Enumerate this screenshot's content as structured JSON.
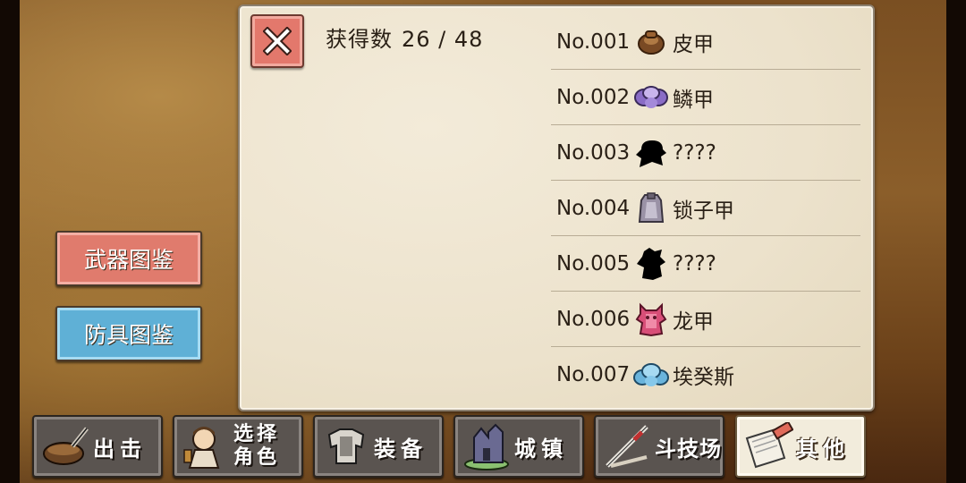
{
  "collection": {
    "count_label": "获得数",
    "count_value": "26 / 48"
  },
  "close_icon": "close-x-icon",
  "side_buttons": {
    "weapon_label": "武器图鉴",
    "armor_label": "防具图鉴"
  },
  "armor_list": [
    {
      "no": "No.001",
      "name": "皮甲",
      "icon": "leather-armor-icon"
    },
    {
      "no": "No.002",
      "name": "鳞甲",
      "icon": "scale-armor-icon"
    },
    {
      "no": "No.003",
      "name": "????",
      "icon": "unknown-silhouette-icon"
    },
    {
      "no": "No.004",
      "name": "锁子甲",
      "icon": "chain-mail-icon"
    },
    {
      "no": "No.005",
      "name": "????",
      "icon": "unknown-silhouette-icon"
    },
    {
      "no": "No.006",
      "name": "龙甲",
      "icon": "dragon-armor-icon"
    },
    {
      "no": "No.007",
      "name": "埃癸斯",
      "icon": "aegis-armor-icon"
    }
  ],
  "nav": {
    "sortie": "出击",
    "select_line1": "选择",
    "select_line2": "角色",
    "equip": "装备",
    "town": "城镇",
    "arena": "斗技场",
    "other": "其他"
  },
  "colors": {
    "close_button": "#e3786c",
    "weapon_button": "#e07b6d",
    "armor_button": "#5fb0d6",
    "active_nav": "#f2ecdc"
  }
}
